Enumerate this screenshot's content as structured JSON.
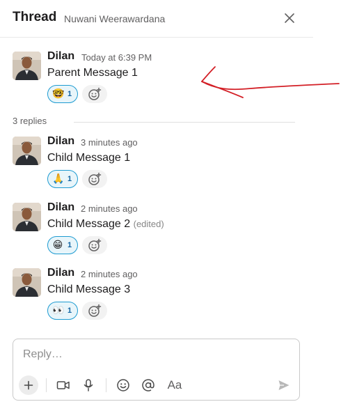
{
  "header": {
    "title": "Thread",
    "subtitle": "Nuwani Weerawardana",
    "close_icon": "close-icon"
  },
  "parent": {
    "author": "Dilan",
    "time": "Today at 6:39 PM",
    "text": "Parent Message 1",
    "reaction": {
      "emoji": "🤓",
      "emoji_name": "nerd-face",
      "count": "1"
    }
  },
  "replies_label": "3 replies",
  "replies": [
    {
      "author": "Dilan",
      "time": "3 minutes ago",
      "text": "Child Message 1",
      "edited": "",
      "reaction": {
        "emoji": "🙏",
        "emoji_name": "folded-hands",
        "count": "1"
      }
    },
    {
      "author": "Dilan",
      "time": "2 minutes ago",
      "text": "Child Message 2",
      "edited": "(edited)",
      "reaction": {
        "emoji": "😁",
        "emoji_name": "grinning-face",
        "count": "1"
      }
    },
    {
      "author": "Dilan",
      "time": "2 minutes ago",
      "text": "Child Message 3",
      "edited": "",
      "reaction": {
        "emoji": "👀",
        "emoji_name": "eyes",
        "count": "1"
      }
    }
  ],
  "composer": {
    "placeholder": "Reply…",
    "format_label": "Aa"
  },
  "colors": {
    "accent": "#1264a3",
    "reaction_border": "#1d9bd1",
    "annotation": "#d31f26"
  }
}
